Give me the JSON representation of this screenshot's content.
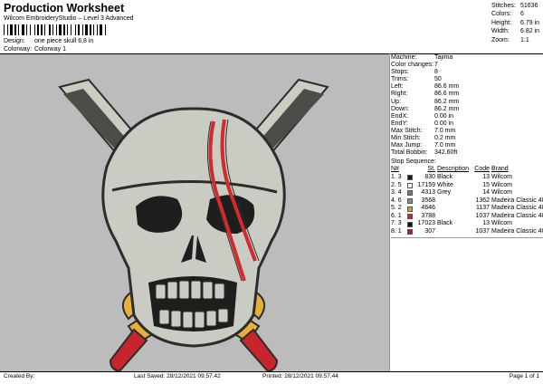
{
  "header": {
    "title": "Production Worksheet",
    "subtitle": "Wilcom EmbroideryStudio – Level 3 Advanced",
    "design_label": "Design:",
    "design_value": "one piece skull 6,8 in",
    "colorway_label": "Colorway:",
    "colorway_value": "Colorway 1"
  },
  "summary": [
    {
      "label": "Stitches:",
      "value": "51636"
    },
    {
      "label": "Colors:",
      "value": "6"
    },
    {
      "label": "Height:",
      "value": "6.79 in"
    },
    {
      "label": "Width:",
      "value": "6.82 in"
    },
    {
      "label": "Zoom:",
      "value": "1:1"
    }
  ],
  "machine": [
    {
      "label": "Machine:",
      "value": "Tajima"
    },
    {
      "label": "Color changes:",
      "value": "7"
    },
    {
      "label": "Stops:",
      "value": "8"
    },
    {
      "label": "Trims:",
      "value": "50"
    },
    {
      "label": "Left:",
      "value": "86.6 mm"
    },
    {
      "label": "Right:",
      "value": "86.6 mm"
    },
    {
      "label": "Up:",
      "value": "86.2 mm"
    },
    {
      "label": "Down:",
      "value": "86.2 mm"
    },
    {
      "label": "EndX:",
      "value": "0.00 in"
    },
    {
      "label": "EndY:",
      "value": "0.00 in"
    },
    {
      "label": "Max Stitch:",
      "value": "7.0 mm"
    },
    {
      "label": "Min Stitch:",
      "value": "0.2 mm"
    },
    {
      "label": "Max Jump:",
      "value": "7.0 mm"
    },
    {
      "label": "Total Bobbin:",
      "value": "342.60ft"
    }
  ],
  "stop_sequence": {
    "title": "Stop Sequence:",
    "headers": {
      "n": "N#",
      "st": "St.",
      "desc": "Description",
      "code": "Code",
      "brand": "Brand"
    },
    "rows": [
      {
        "num": "1. 3",
        "color": "#1a1a1a",
        "st": "830",
        "desc": "Black",
        "code": "13",
        "brand": "Wilcom"
      },
      {
        "num": "2. 5",
        "color": "#ffffff",
        "st": "17159",
        "desc": "White",
        "code": "15",
        "brand": "Wilcom"
      },
      {
        "num": "3. 4",
        "color": "#7a7a7a",
        "st": "4313",
        "desc": "Grey",
        "code": "14",
        "brand": "Wilcom"
      },
      {
        "num": "4. 6",
        "color": "#8a8a8a",
        "st": "3568",
        "desc": "",
        "code": "1362",
        "brand": "Madeira Classic 40"
      },
      {
        "num": "5. 2",
        "color": "#e8961e",
        "st": "4646",
        "desc": "",
        "code": "1137",
        "brand": "Madeira Classic 40"
      },
      {
        "num": "6. 1",
        "color": "#d8202a",
        "st": "3788",
        "desc": "",
        "code": "1037",
        "brand": "Madeira Classic 40"
      },
      {
        "num": "7. 3",
        "color": "#111111",
        "st": "17023",
        "desc": "Black",
        "code": "13",
        "brand": "Wilcom"
      },
      {
        "num": "8. 1",
        "color": "#b01822",
        "st": "307",
        "desc": "",
        "code": "1037",
        "brand": "Madeira Classic 40"
      }
    ]
  },
  "footer": {
    "created_by": "Created By:",
    "last_saved": "Last Saved: 28/12/2021 09.57.42",
    "printed": "Printed: 28/12/2021 09.57.44",
    "page": "Page 1 of 1"
  },
  "artwork": {
    "icon": "pirate-skull-crossed-swords-icon",
    "colors": {
      "background": "#bcbcbc",
      "blade": "#c9cec0",
      "skull": "#c9ccc2",
      "outline": "#2c2c2c",
      "gold": "#e7b03a",
      "red": "#c8242c",
      "scar": "#d22a2f"
    }
  }
}
